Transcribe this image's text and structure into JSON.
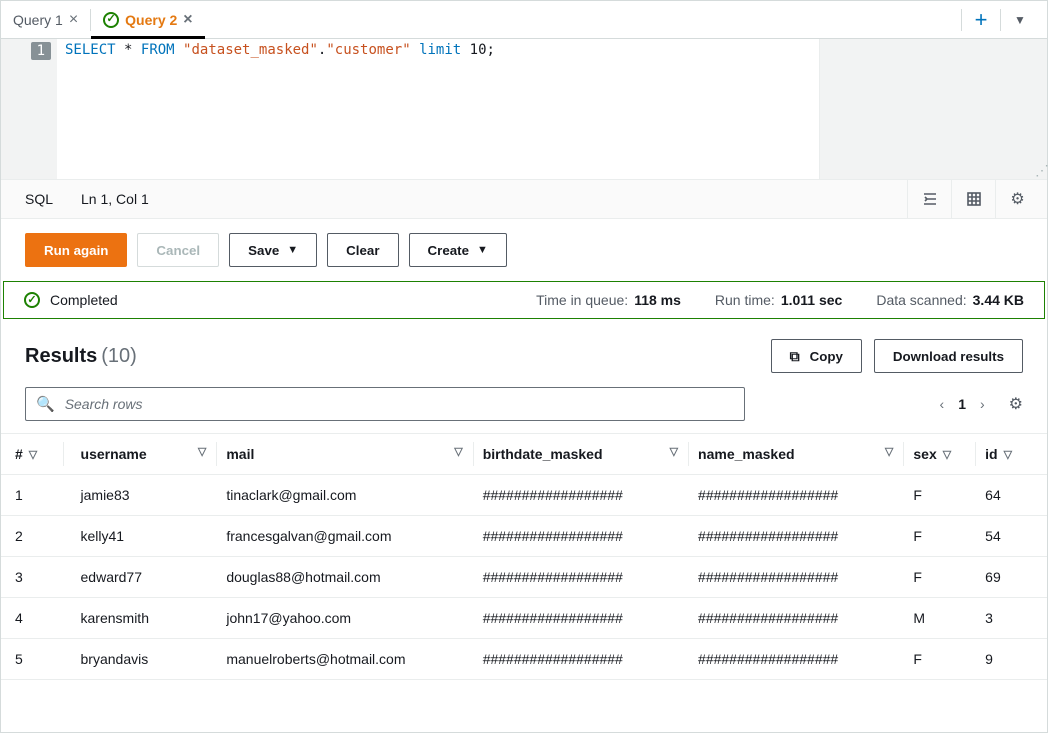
{
  "tabs": {
    "items": [
      {
        "label": "Query 1",
        "active": false,
        "status": null
      },
      {
        "label": "Query 2",
        "active": true,
        "status": "success"
      }
    ]
  },
  "editor": {
    "sql_tokens": [
      {
        "t": "SELECT",
        "c": "kw"
      },
      {
        "t": " ",
        "c": "op"
      },
      {
        "t": "*",
        "c": "op"
      },
      {
        "t": " ",
        "c": "op"
      },
      {
        "t": "FROM",
        "c": "kw"
      },
      {
        "t": " ",
        "c": "op"
      },
      {
        "t": "\"dataset_masked\"",
        "c": "str"
      },
      {
        "t": ".",
        "c": "op"
      },
      {
        "t": "\"customer\"",
        "c": "str"
      },
      {
        "t": " ",
        "c": "op"
      },
      {
        "t": "limit",
        "c": "kw"
      },
      {
        "t": " ",
        "c": "op"
      },
      {
        "t": "10",
        "c": "op"
      },
      {
        "t": ";",
        "c": "op"
      }
    ],
    "line_number": "1"
  },
  "statusbar": {
    "lang": "SQL",
    "pos": "Ln 1, Col 1"
  },
  "toolbar": {
    "run": "Run again",
    "cancel": "Cancel",
    "save": "Save",
    "clear": "Clear",
    "create": "Create"
  },
  "banner": {
    "status": "Completed",
    "queue_label": "Time in queue:",
    "queue_value": "118 ms",
    "runtime_label": "Run time:",
    "runtime_value": "1.011 sec",
    "scanned_label": "Data scanned:",
    "scanned_value": "3.44 KB"
  },
  "results": {
    "title": "Results",
    "count": "(10)",
    "copy": "Copy",
    "download": "Download results",
    "search_placeholder": "Search rows",
    "page": "1",
    "columns": [
      "#",
      "username",
      "mail",
      "birthdate_masked",
      "name_masked",
      "sex",
      "id"
    ],
    "rows": [
      {
        "n": "1",
        "username": "jamie83",
        "mail": "tinaclark@gmail.com",
        "bd": "##################",
        "nm": "##################",
        "sex": "F",
        "id": "64"
      },
      {
        "n": "2",
        "username": "kelly41",
        "mail": "francesgalvan@gmail.com",
        "bd": "##################",
        "nm": "##################",
        "sex": "F",
        "id": "54"
      },
      {
        "n": "3",
        "username": "edward77",
        "mail": "douglas88@hotmail.com",
        "bd": "##################",
        "nm": "##################",
        "sex": "F",
        "id": "69"
      },
      {
        "n": "4",
        "username": "karensmith",
        "mail": "john17@yahoo.com",
        "bd": "##################",
        "nm": "##################",
        "sex": "M",
        "id": "3"
      },
      {
        "n": "5",
        "username": "bryandavis",
        "mail": "manuelroberts@hotmail.com",
        "bd": "##################",
        "nm": "##################",
        "sex": "F",
        "id": "9"
      }
    ]
  }
}
